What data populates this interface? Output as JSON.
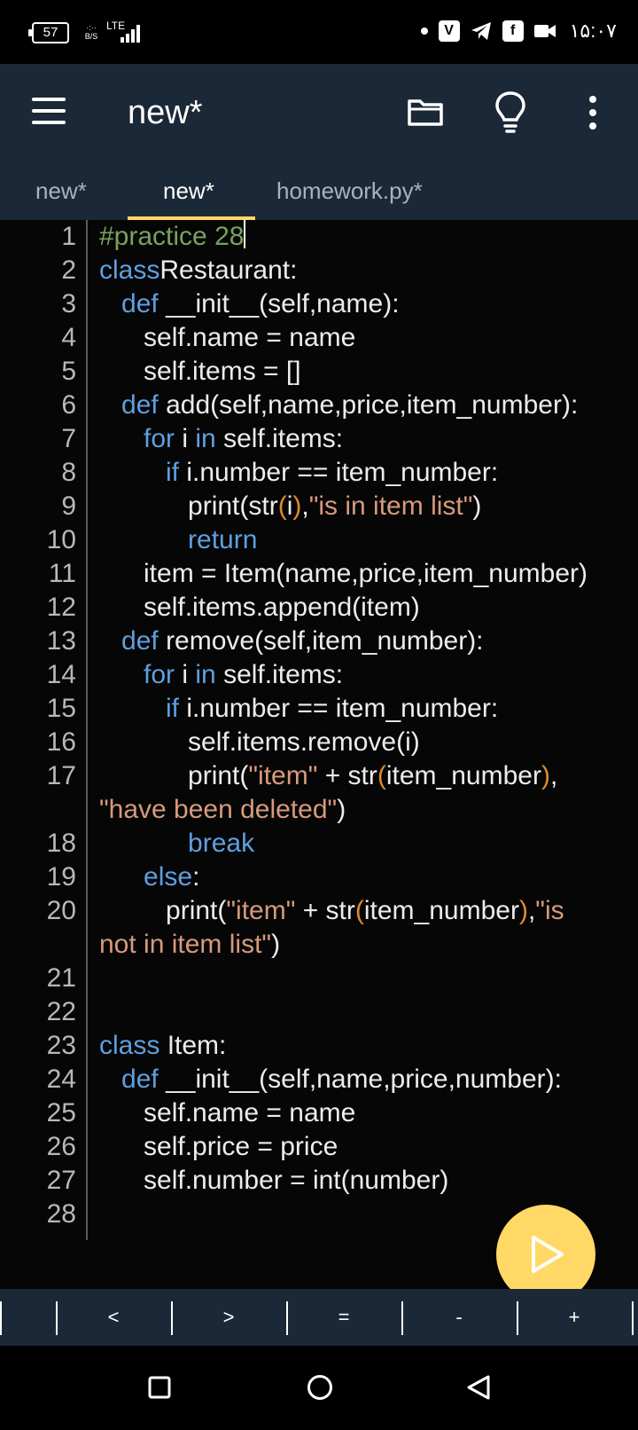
{
  "status_bar": {
    "battery": "57",
    "network_speed": "B/S",
    "network_type": "LTE",
    "time": "۱۵:۰۷",
    "app_icons": [
      "dot-icon",
      "v-app-icon",
      "telegram-icon",
      "facebook-icon",
      "video-icon"
    ]
  },
  "app_bar": {
    "title": "new*"
  },
  "tabs": [
    {
      "label": "new*"
    },
    {
      "label": "new*",
      "active": true
    },
    {
      "label": "homework.py*"
    }
  ],
  "code_lines": [
    {
      "num": "1",
      "tokens": [
        [
          "cm",
          "#practice 28"
        ]
      ]
    },
    {
      "num": "2",
      "tokens": [
        [
          "kw",
          "class"
        ],
        [
          "",
          "Restaurant:"
        ]
      ]
    },
    {
      "num": "3",
      "tokens": [
        [
          "",
          "   "
        ],
        [
          "kw",
          "def"
        ],
        [
          "",
          " __init__(self,name):"
        ]
      ]
    },
    {
      "num": "4",
      "tokens": [
        [
          "",
          "      self.name = name"
        ]
      ]
    },
    {
      "num": "5",
      "tokens": [
        [
          "",
          "      self.items = []"
        ]
      ]
    },
    {
      "num": "6",
      "tokens": [
        [
          "",
          "   "
        ],
        [
          "kw",
          "def"
        ],
        [
          "",
          " add(self,name,price,item_number):"
        ]
      ]
    },
    {
      "num": "7",
      "tokens": [
        [
          "",
          "      "
        ],
        [
          "kw",
          "for"
        ],
        [
          "",
          " i "
        ],
        [
          "kw",
          "in"
        ],
        [
          "",
          " self.items:"
        ]
      ]
    },
    {
      "num": "8",
      "tokens": [
        [
          "",
          "         "
        ],
        [
          "kw",
          "if"
        ],
        [
          "",
          " i.number == item_number:"
        ]
      ]
    },
    {
      "num": "9",
      "tokens": [
        [
          "",
          "            print(str"
        ],
        [
          "pr",
          "("
        ],
        [
          "",
          "i"
        ],
        [
          "pr",
          ")"
        ],
        [
          "",
          ","
        ],
        [
          "st",
          "\"is in item list\""
        ],
        [
          "",
          ")"
        ]
      ]
    },
    {
      "num": "10",
      "tokens": [
        [
          "",
          "            "
        ],
        [
          "kw",
          "return"
        ]
      ]
    },
    {
      "num": "11",
      "tokens": [
        [
          "",
          "      item = Item(name,price,item_number)"
        ]
      ]
    },
    {
      "num": "12",
      "tokens": [
        [
          "",
          "      self.items.append(item)"
        ]
      ]
    },
    {
      "num": "13",
      "tokens": [
        [
          "",
          "   "
        ],
        [
          "kw",
          "def"
        ],
        [
          "",
          " remove(self,item_number):"
        ]
      ]
    },
    {
      "num": "14",
      "tokens": [
        [
          "",
          "      "
        ],
        [
          "kw",
          "for"
        ],
        [
          "",
          " i "
        ],
        [
          "kw",
          "in"
        ],
        [
          "",
          " self.items:"
        ]
      ]
    },
    {
      "num": "15",
      "tokens": [
        [
          "",
          "         "
        ],
        [
          "kw",
          "if"
        ],
        [
          "",
          " i.number == item_number:"
        ]
      ]
    },
    {
      "num": "16",
      "tokens": [
        [
          "",
          "            self.items.remove(i)"
        ]
      ]
    },
    {
      "num": "17",
      "tokens": [
        [
          "",
          "            print("
        ],
        [
          "st",
          "\"item\""
        ],
        [
          "",
          " + str"
        ],
        [
          "pr",
          "("
        ],
        [
          "",
          "item_number"
        ],
        [
          "pr",
          ")"
        ],
        [
          "",
          ","
        ]
      ]
    },
    {
      "num": "",
      "tokens": [
        [
          "st",
          "\"have been deleted\""
        ],
        [
          "",
          ")"
        ]
      ]
    },
    {
      "num": "18",
      "tokens": [
        [
          "",
          "            "
        ],
        [
          "kw",
          "break"
        ]
      ]
    },
    {
      "num": "19",
      "tokens": [
        [
          "",
          "      "
        ],
        [
          "kw",
          "else"
        ],
        [
          "",
          ":"
        ]
      ]
    },
    {
      "num": "20",
      "tokens": [
        [
          "",
          "         print("
        ],
        [
          "st",
          "\"item\""
        ],
        [
          "",
          " + str"
        ],
        [
          "pr",
          "("
        ],
        [
          "",
          "item_number"
        ],
        [
          "pr",
          ")"
        ],
        [
          "",
          ","
        ],
        [
          "st",
          "\"is"
        ]
      ]
    },
    {
      "num": "",
      "tokens": [
        [
          "st",
          "not in item list\""
        ],
        [
          "",
          ")"
        ]
      ]
    },
    {
      "num": "21",
      "tokens": []
    },
    {
      "num": "22",
      "tokens": []
    },
    {
      "num": "23",
      "tokens": [
        [
          "kw",
          "class"
        ],
        [
          "",
          " Item:"
        ]
      ]
    },
    {
      "num": "24",
      "tokens": [
        [
          "",
          "   "
        ],
        [
          "kw",
          "def"
        ],
        [
          "",
          " __init__(self,name,price,number):"
        ]
      ]
    },
    {
      "num": "25",
      "tokens": [
        [
          "",
          "      self.name = name"
        ]
      ]
    },
    {
      "num": "26",
      "tokens": [
        [
          "",
          "      self.price = price"
        ]
      ]
    },
    {
      "num": "27",
      "tokens": [
        [
          "",
          "      self.number = int(number)"
        ]
      ]
    },
    {
      "num": "28",
      "tokens": []
    }
  ],
  "symbol_bar": [
    "<",
    ">",
    "=",
    "-",
    "+"
  ],
  "run_button_icon": "play-icon",
  "nav_bar_icons": [
    "recents-square-icon",
    "home-circle-icon",
    "back-triangle-icon"
  ],
  "colors": {
    "app_bar": "#1b2837",
    "accent": "#ffd866",
    "comment": "#78a35c",
    "keyword": "#5f9fe0",
    "string": "#d79a7c",
    "paren": "#e08a2c"
  }
}
